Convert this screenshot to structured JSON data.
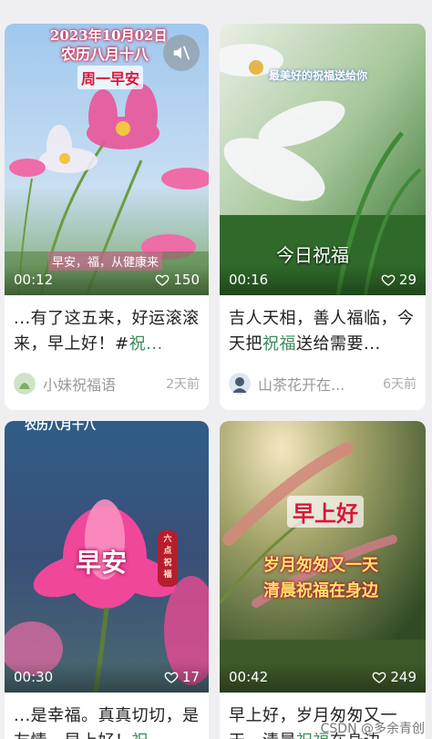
{
  "cards": [
    {
      "overlay_date": "2023年10月02日",
      "overlay_lunar": "农历八月十八",
      "overlay_greeting": "周一早安",
      "overlay_banner": "早安，福，从健康来",
      "duration": "00:12",
      "likes": "150",
      "caption_before": "...有了这五来，好运滚滚来，早上好！#",
      "caption_highlight": "祝...",
      "author": "小妹祝福语",
      "time_ago": "2天前"
    },
    {
      "overlay_top": "最美好的祝福送给你",
      "overlay_mid": "今日祝福",
      "duration": "00:16",
      "likes": "29",
      "caption_before": "吉人天相，善人福临，今天把",
      "caption_highlight": "祝福",
      "caption_after": "送给需要...",
      "author": "山茶花开在...",
      "time_ago": "6天前"
    },
    {
      "overlay_top": "农历八月十八",
      "overlay_main": "早安",
      "overlay_seal": "六点祝福",
      "duration": "00:30",
      "likes": "17",
      "caption_before": "...是幸福。真真切切，",
      "caption_line2": "是友情，早上好！",
      "caption_highlight": "祝"
    },
    {
      "overlay_main": "早上好",
      "overlay_line1": "岁月匆匆又一天",
      "overlay_line2": "清晨祝福在身边",
      "duration": "00:42",
      "likes": "249",
      "caption_before": "早上好，岁月匆匆又一",
      "caption_line2": "天，清晨",
      "caption_highlight": "祝福",
      "caption_after": "在身边"
    }
  ],
  "watermark": "CSDN @多余青创",
  "colors": {
    "accent_green": "#3a8a5a",
    "overlay_red": "#d8173a",
    "overlay_gold": "#ffe36a"
  },
  "icons": {
    "mute": "speaker-muted-icon",
    "likes": "heart-outline-icon"
  }
}
